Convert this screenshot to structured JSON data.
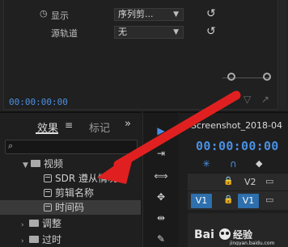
{
  "effect_controls": {
    "rows": [
      {
        "label": "显示",
        "value": "序列剪..."
      },
      {
        "label": "源轨道",
        "value": "无"
      }
    ],
    "timecode": "00:00:00:00"
  },
  "effects_panel": {
    "tabs": [
      {
        "label": "效果"
      },
      {
        "label": "标记"
      }
    ],
    "menu_icon": "hamburger-icon",
    "overflow_label": "»",
    "search_icon": "magnifier-icon",
    "tree": [
      {
        "label": "视频",
        "type": "folder",
        "expanded": true
      },
      {
        "label": "SDR 遵从情况",
        "type": "effect"
      },
      {
        "label": "剪辑名称",
        "type": "effect"
      },
      {
        "label": "时间码",
        "type": "effect",
        "selected": true
      },
      {
        "label": "调整",
        "type": "folder",
        "expanded": false
      },
      {
        "label": "过时",
        "type": "folder",
        "expanded": false
      }
    ]
  },
  "timeline": {
    "tab_label": "Screenshot_2018-04",
    "timecode": "00:00:00:00",
    "tracks": [
      {
        "label": "V2"
      },
      {
        "source": "V1",
        "target": "V1"
      }
    ]
  },
  "colors": {
    "accent_blue": "#4a90e2",
    "track_blue": "#2e6fad",
    "arrow_red": "#e02020"
  }
}
